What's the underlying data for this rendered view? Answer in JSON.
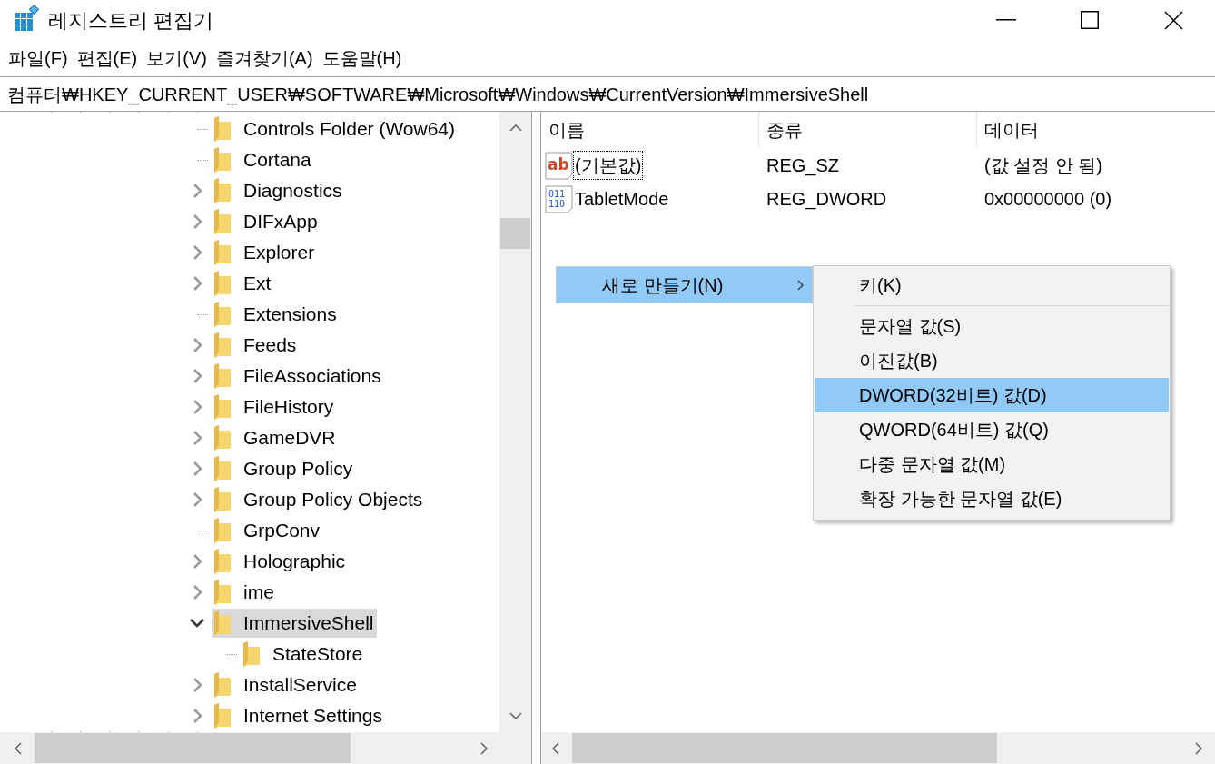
{
  "window": {
    "title": "레지스트리 편집기"
  },
  "menu_bar": [
    "파일(F)",
    "편집(E)",
    "보기(V)",
    "즐겨찾기(A)",
    "도움말(H)"
  ],
  "address": "컴퓨터₩HKEY_CURRENT_USER₩SOFTWARE₩Microsoft₩Windows₩CurrentVersion₩ImmersiveShell",
  "tree": {
    "items": [
      {
        "label": "Controls Folder (Wow64)",
        "selected": false
      },
      {
        "label": "Cortana",
        "selected": false
      },
      {
        "label": "Diagnostics",
        "expanded": false,
        "selected": false
      },
      {
        "label": "DIFxApp",
        "expanded": false,
        "selected": false
      },
      {
        "label": "Explorer",
        "expanded": false,
        "selected": false
      },
      {
        "label": "Ext",
        "expanded": false,
        "selected": false
      },
      {
        "label": "Extensions",
        "selected": false
      },
      {
        "label": "Feeds",
        "expanded": false,
        "selected": false
      },
      {
        "label": "FileAssociations",
        "expanded": false,
        "selected": false
      },
      {
        "label": "FileHistory",
        "expanded": false,
        "selected": false
      },
      {
        "label": "GameDVR",
        "expanded": false,
        "selected": false
      },
      {
        "label": "Group Policy",
        "expanded": false,
        "selected": false
      },
      {
        "label": "Group Policy Objects",
        "expanded": false,
        "selected": false
      },
      {
        "label": "GrpConv",
        "selected": false
      },
      {
        "label": "Holographic",
        "expanded": false,
        "selected": false
      },
      {
        "label": "ime",
        "expanded": false,
        "selected": false
      },
      {
        "label": "ImmersiveShell",
        "expanded": true,
        "selected": true,
        "children": [
          {
            "label": "StateStore",
            "selected": false
          }
        ]
      },
      {
        "label": "InstallService",
        "expanded": false,
        "selected": false
      },
      {
        "label": "Internet Settings",
        "expanded": false,
        "selected": false
      }
    ]
  },
  "values": {
    "columns": [
      "이름",
      "종류",
      "데이터"
    ],
    "rows": [
      {
        "kind": "string",
        "icon_lines": [
          "ab"
        ],
        "name": "(기본값)",
        "type": "REG_SZ",
        "data": "(값 설정 안 됨)",
        "focused": true
      },
      {
        "kind": "binary",
        "icon_lines": [
          "011",
          "110"
        ],
        "name": "TabletMode",
        "type": "REG_DWORD",
        "data": "0x00000000 (0)",
        "focused": false
      }
    ]
  },
  "context_menu": {
    "items": [
      {
        "label": "새로 만들기(N)",
        "has_submenu": true,
        "selected": true
      }
    ]
  },
  "submenu": {
    "items": [
      {
        "kind": "item",
        "label": "키(K)",
        "selected": false
      },
      {
        "kind": "separator"
      },
      {
        "kind": "item",
        "label": "문자열 값(S)",
        "selected": false
      },
      {
        "kind": "item",
        "label": "이진값(B)",
        "selected": false
      },
      {
        "kind": "item",
        "label": "DWORD(32비트) 값(D)",
        "selected": true
      },
      {
        "kind": "item",
        "label": "QWORD(64비트) 값(Q)",
        "selected": false
      },
      {
        "kind": "item",
        "label": "다중 문자열 값(M)",
        "selected": false
      },
      {
        "kind": "item",
        "label": "확장 가능한 문자열 값(E)",
        "selected": false
      }
    ]
  }
}
